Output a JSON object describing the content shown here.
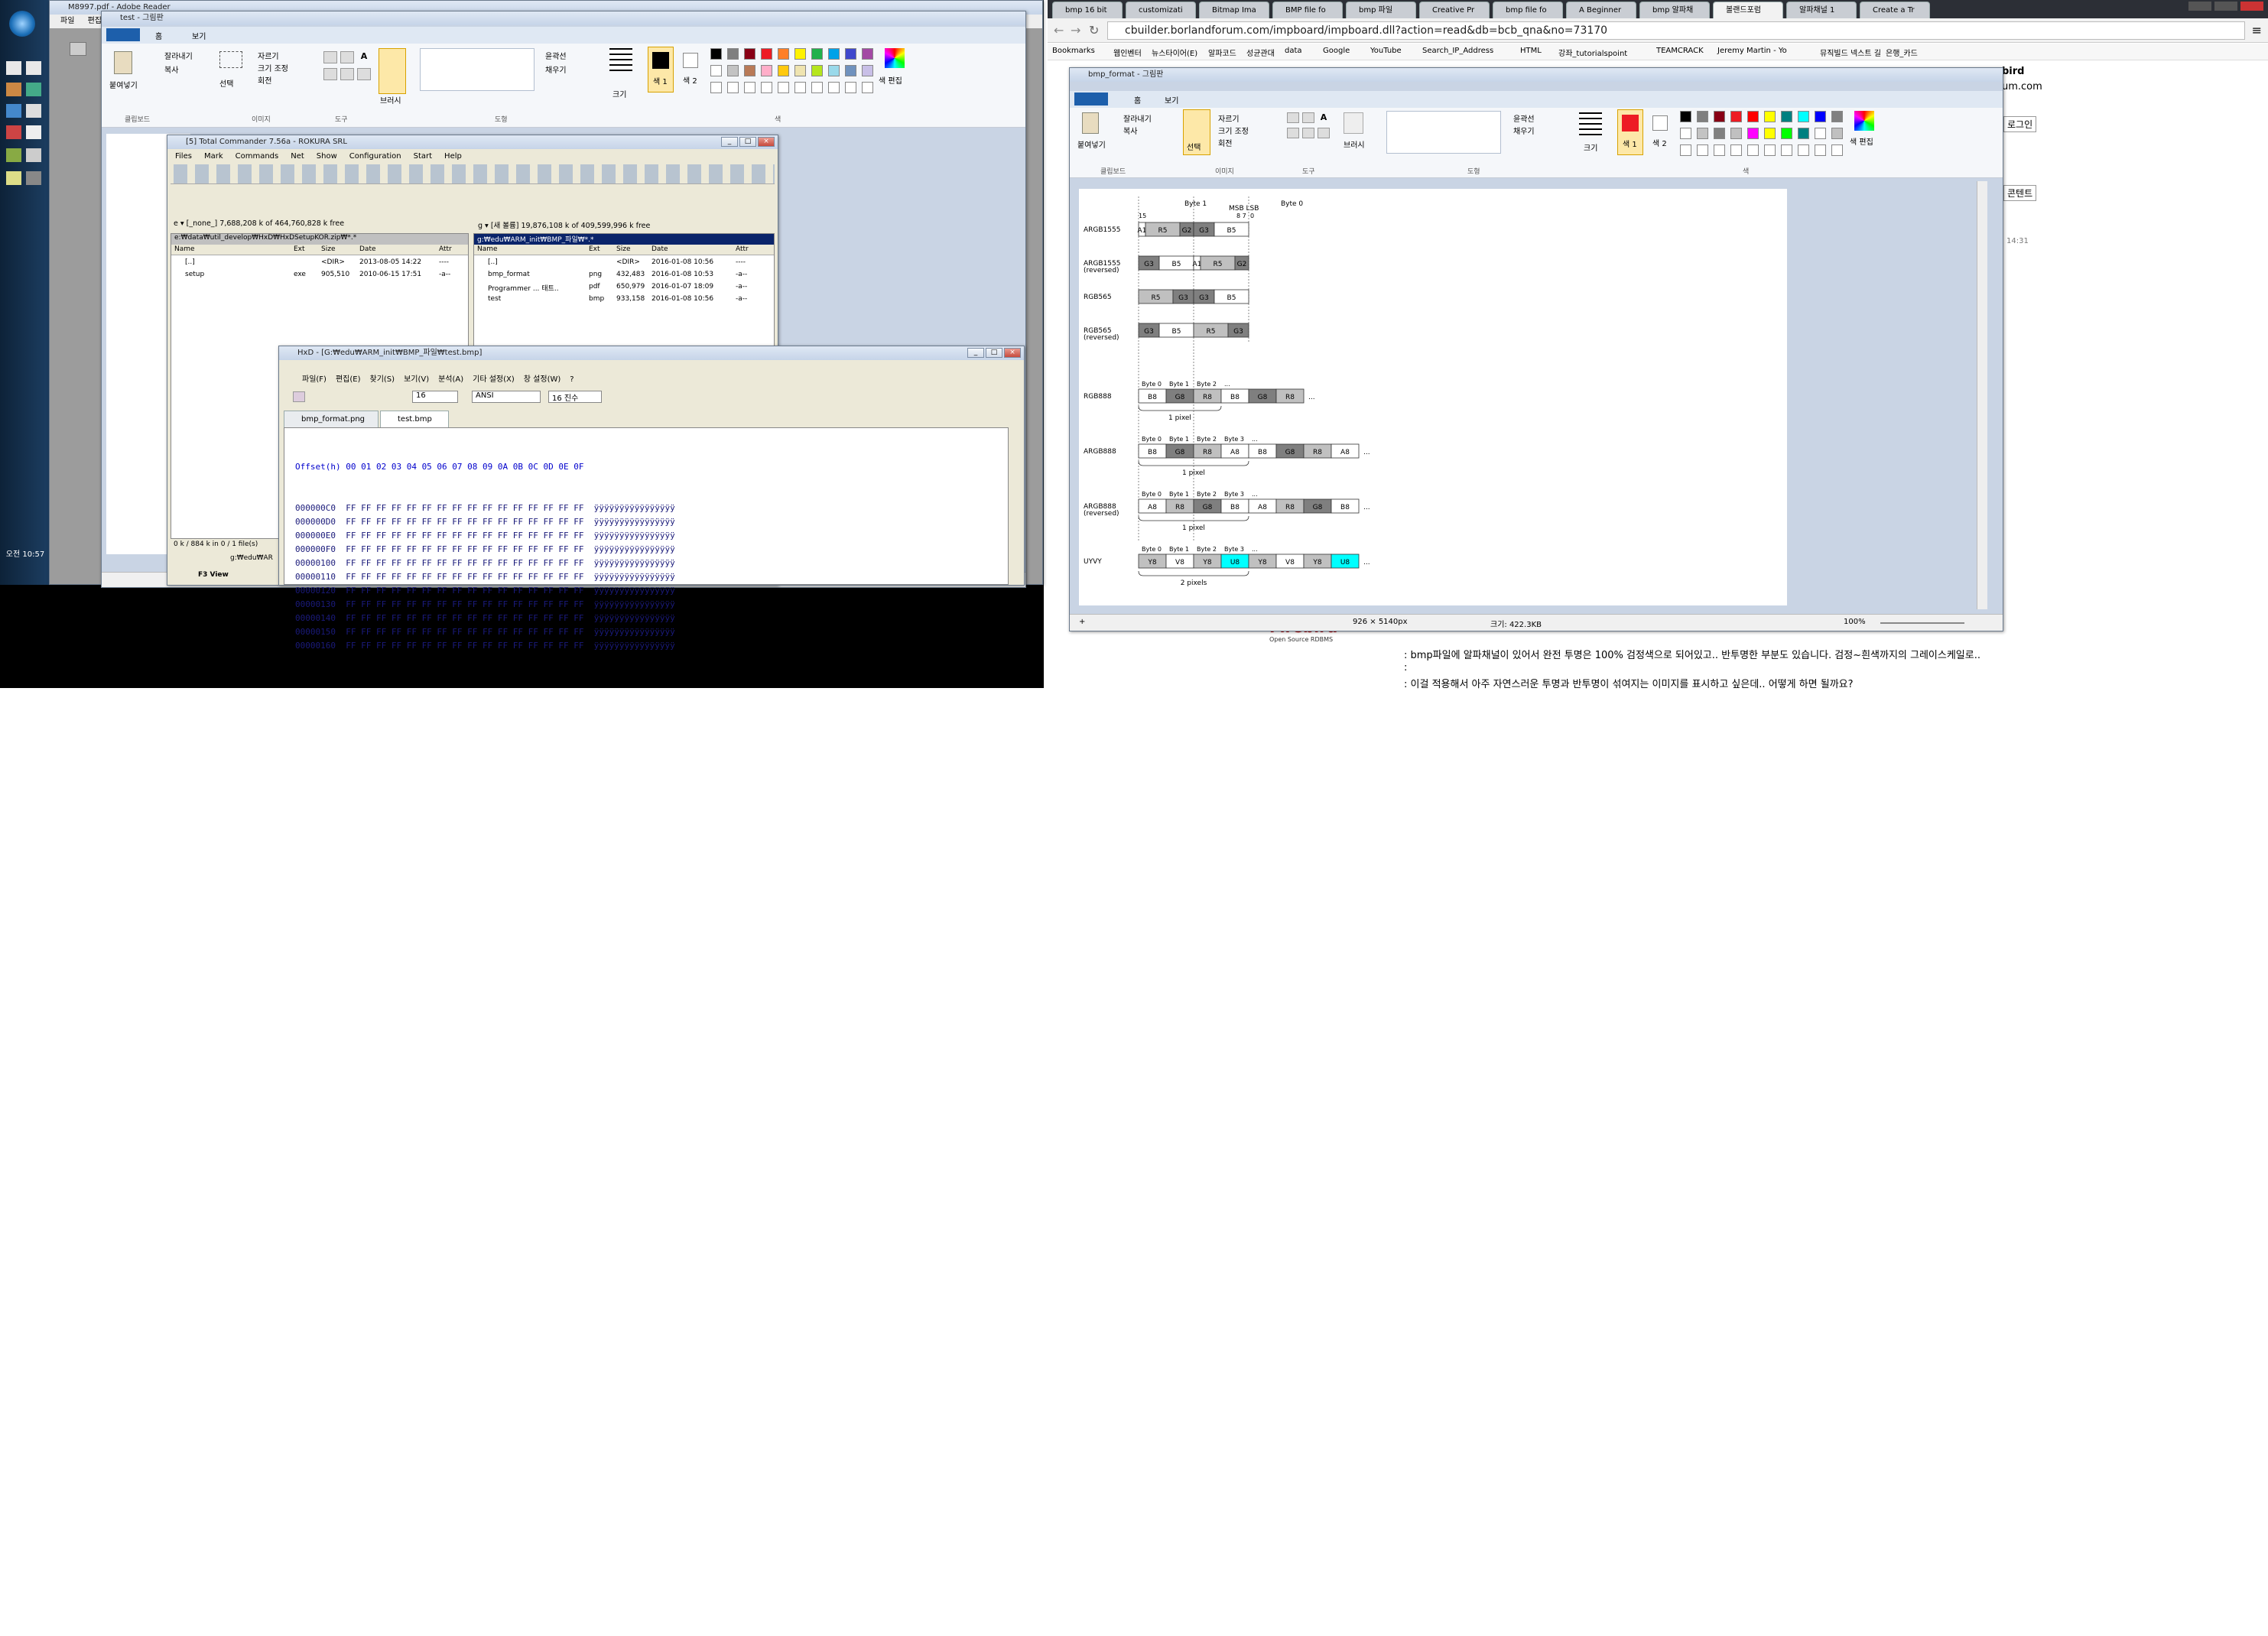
{
  "desktop": {
    "clock": "오전 10:57"
  },
  "left_monitor": {
    "reader_title": "M8997.pdf - Adobe Reader",
    "reader_menu": [
      "파일",
      "편집"
    ],
    "paint": {
      "title": "test - 그림판",
      "tabs": [
        "홈",
        "보기"
      ],
      "clipboard": {
        "paste": "붙여넣기",
        "cut": "잘라내기",
        "copy": "복사",
        "label": "클립보드"
      },
      "image": {
        "select": "선택",
        "crop": "자르기",
        "resize": "크기 조정",
        "rotate": "회전",
        "label": "이미지"
      },
      "tools_label": "도구",
      "brush": "브러시",
      "shapes": {
        "outline": "윤곽선",
        "fill": "채우기",
        "label": "도형"
      },
      "size": "크기",
      "color1": "색 1",
      "color2": "색 2",
      "edit_colors": "색 편집",
      "colors_label": "색"
    },
    "tc": {
      "title": "[5] Total Commander 7.56a - ROKURA SRL",
      "menu": [
        "Files",
        "Mark",
        "Commands",
        "Net",
        "Show",
        "Configuration",
        "Start",
        "Help"
      ],
      "left_drive": "e  ▾  [_none_]  7,688,208 k of 464,760,828 k free",
      "right_drive": "g  ▾  [새 볼륨]  19,876,108 k of 409,599,996 k free",
      "left_path": "e:₩data₩util_develop₩HxD₩HxDSetupKOR.zip₩*.*",
      "right_path": "g:₩edu₩ARM_init₩BMP_파일₩*.*",
      "cols": [
        "Name",
        "Ext",
        "Size",
        "Date",
        "Attr"
      ],
      "left_rows": [
        {
          "name": "[..]",
          "ext": "",
          "size": "<DIR>",
          "date": "2013-08-05 14:22",
          "attr": "----"
        },
        {
          "name": "setup",
          "ext": "exe",
          "size": "905,510",
          "date": "2010-06-15 17:51",
          "attr": "-a--"
        }
      ],
      "right_rows": [
        {
          "name": "[..]",
          "ext": "",
          "size": "<DIR>",
          "date": "2016-01-08 10:56",
          "attr": "----"
        },
        {
          "name": "bmp_format",
          "ext": "png",
          "size": "432,483",
          "date": "2016-01-08 10:53",
          "attr": "-a--"
        },
        {
          "name": "Programmer ... 태트..",
          "ext": "pdf",
          "size": "650,979",
          "date": "2016-01-07 18:09",
          "attr": "-a--"
        },
        {
          "name": "test",
          "ext": "bmp",
          "size": "933,158",
          "date": "2016-01-08 10:56",
          "attr": "-a--"
        }
      ],
      "status": "0 k / 884 k in 0 / 1 file(s)",
      "cmdpath": "g:₩edu₩AR",
      "f3": "F3 View"
    },
    "hxd": {
      "title": "HxD - [G:₩edu₩ARM_init₩BMP_파일₩test.bmp]",
      "menu": [
        "파일(F)",
        "편집(E)",
        "찾기(S)",
        "보기(V)",
        "분석(A)",
        "기타 설정(X)",
        "창 설정(W)",
        "?"
      ],
      "cols_value": "16",
      "charset": "ANSI",
      "base": "16 진수",
      "tabs": [
        "bmp_format.png",
        "test.bmp"
      ],
      "header": "Offset(h) 00 01 02 03 04 05 06 07 08 09 0A 0B 0C 0D 0E 0F",
      "rows": [
        "000000C0  FF FF FF FF FF FF FF FF FF FF FF FF FF FF FF FF  ÿÿÿÿÿÿÿÿÿÿÿÿÿÿÿÿ",
        "000000D0  FF FF FF FF FF FF FF FF FF FF FF FF FF FF FF FF  ÿÿÿÿÿÿÿÿÿÿÿÿÿÿÿÿ",
        "000000E0  FF FF FF FF FF FF FF FF FF FF FF FF FF FF FF FF  ÿÿÿÿÿÿÿÿÿÿÿÿÿÿÿÿ",
        "000000F0  FF FF FF FF FF FF FF FF FF FF FF FF FF FF FF FF  ÿÿÿÿÿÿÿÿÿÿÿÿÿÿÿÿ",
        "00000100  FF FF FF FF FF FF FF FF FF FF FF FF FF FF FF FF  ÿÿÿÿÿÿÿÿÿÿÿÿÿÿÿÿ",
        "00000110  FF FF FF FF FF FF FF FF FF FF FF FF FF FF FF FF  ÿÿÿÿÿÿÿÿÿÿÿÿÿÿÿÿ",
        "00000120  FF FF FF FF FF FF FF FF FF FF FF FF FF FF FF FF  ÿÿÿÿÿÿÿÿÿÿÿÿÿÿÿÿ",
        "00000130  FF FF FF FF FF FF FF FF FF FF FF FF FF FF FF FF  ÿÿÿÿÿÿÿÿÿÿÿÿÿÿÿÿ",
        "00000140  FF FF FF FF FF FF FF FF FF FF FF FF FF FF FF FF  ÿÿÿÿÿÿÿÿÿÿÿÿÿÿÿÿ",
        "00000150  FF FF FF FF FF FF FF FF FF FF FF FF FF FF FF FF  ÿÿÿÿÿÿÿÿÿÿÿÿÿÿÿÿ",
        "00000160  FF FF FF FF FF FF FF FF FF FF FF FF FF FF FF FF  ÿÿÿÿÿÿÿÿÿÿÿÿÿÿÿÿ"
      ]
    }
  },
  "browser": {
    "tabs": [
      "bmp 16 bit",
      "customizati",
      "Bitmap Ima",
      "BMP file fo",
      "bmp 파일",
      "Creative Pr",
      "bmp file fo",
      "A Beginner",
      "bmp 알파채",
      "볼랜드포럼",
      "알파채널 1",
      "Create a Tr"
    ],
    "url": "cbuilder.borlandforum.com/impboard/impboard.dll?action=read&db=bcb_qna&no=73170",
    "bookmarks": [
      "Bookmarks",
      "웹인벤터",
      "뉴스타이어(E)",
      "알파코드",
      "성균관대",
      "data",
      "Google",
      "YouTube",
      "Search_IP_Address",
      "HTML",
      "강좌_tutorialspoint",
      "TEAMCRACK",
      "Jeremy Martin - Yo",
      "뮤직빌드 넥스트 길",
      "은행_카드"
    ],
    "side": [
      "bird",
      "um.com",
      "로그인",
      "콘텐트",
      "14:31"
    ],
    "post": [
      ": bmp파일에 알파채널이 있어서 완전 투명은 100% 검정색으로 되어있고.. 반투명한 부분도 있습니다. 검정~흰색까지의 그레이스케일로..",
      ":",
      ": 이걸 적용해서 아주 자연스러운 투명과 반투명이 섞여지는 이미지를 표시하고 싶은데.. 어떻게 하면 될까요?"
    ],
    "logo_text": "Firebird",
    "logo_sub": "Open Source RDBMS"
  },
  "paint2": {
    "title": "bmp_format - 그림판",
    "tabs": [
      "홈",
      "보기"
    ],
    "clipboard": {
      "paste": "붙여넣기",
      "cut": "잘라내기",
      "copy": "복사",
      "label": "클립보드"
    },
    "image": {
      "select": "선택",
      "crop": "자르기",
      "resize": "크기 조정",
      "rotate": "회전",
      "label": "이미지"
    },
    "tools_label": "도구",
    "brush": "브러시",
    "shapes": {
      "outline": "윤곽선",
      "fill": "채우기",
      "label": "도형"
    },
    "size": "크기",
    "color1": "색 1",
    "color2": "색 2",
    "edit_colors": "색 편집",
    "colors_label": "색",
    "status_dims": "926 × 5140px",
    "status_size": "크기: 422.3KB",
    "zoom": "100%"
  },
  "diagram": {
    "top_headers": {
      "byte1": "Byte 1",
      "msb_lsb": "MSB LSB",
      "bits87": "8 7",
      "byte0": "Byte 0",
      "b15": "15",
      "b0": "0"
    },
    "rows": [
      {
        "label": "ARGB1555",
        "cells": [
          {
            "t": "A1",
            "w": 1,
            "c": "w"
          },
          {
            "t": "R5",
            "w": 5,
            "c": "l"
          },
          {
            "t": "G2",
            "w": 2,
            "c": "d"
          },
          {
            "t": "G3",
            "w": 3,
            "c": "d"
          },
          {
            "t": "B5",
            "w": 5,
            "c": "w"
          }
        ]
      },
      {
        "label": "ARGB1555 (reversed)",
        "cells": [
          {
            "t": "G3",
            "w": 3,
            "c": "d"
          },
          {
            "t": "B5",
            "w": 5,
            "c": "w"
          },
          {
            "t": "A1",
            "w": 1,
            "c": "w"
          },
          {
            "t": "R5",
            "w": 5,
            "c": "l"
          },
          {
            "t": "G2",
            "w": 2,
            "c": "d"
          }
        ]
      },
      {
        "label": "RGB565",
        "cells": [
          {
            "t": "R5",
            "w": 5,
            "c": "l"
          },
          {
            "t": "G3",
            "w": 3,
            "c": "d"
          },
          {
            "t": "G3",
            "w": 3,
            "c": "d"
          },
          {
            "t": "B5",
            "w": 5,
            "c": "w"
          }
        ]
      },
      {
        "label": "RGB565 (reversed)",
        "cells": [
          {
            "t": "G3",
            "w": 3,
            "c": "d"
          },
          {
            "t": "B5",
            "w": 5,
            "c": "w"
          },
          {
            "t": "R5",
            "w": 5,
            "c": "l"
          },
          {
            "t": "G3",
            "w": 3,
            "c": "d"
          }
        ]
      }
    ],
    "byte_rows": [
      {
        "label": "RGB888",
        "heads": [
          "Byte 0",
          "Byte 1",
          "Byte 2",
          "..."
        ],
        "cells": [
          {
            "t": "B8",
            "c": "w"
          },
          {
            "t": "G8",
            "c": "d"
          },
          {
            "t": "R8",
            "c": "l"
          },
          {
            "t": "B8",
            "c": "w"
          },
          {
            "t": "G8",
            "c": "d"
          },
          {
            "t": "R8",
            "c": "l"
          }
        ],
        "span": "1 pixel",
        "span_n": 3
      },
      {
        "label": "ARGB888",
        "heads": [
          "Byte 0",
          "Byte 1",
          "Byte 2",
          "Byte 3",
          "..."
        ],
        "cells": [
          {
            "t": "B8",
            "c": "w"
          },
          {
            "t": "G8",
            "c": "d"
          },
          {
            "t": "R8",
            "c": "l"
          },
          {
            "t": "A8",
            "c": "w"
          },
          {
            "t": "B8",
            "c": "w"
          },
          {
            "t": "G8",
            "c": "d"
          },
          {
            "t": "R8",
            "c": "l"
          },
          {
            "t": "A8",
            "c": "w"
          }
        ],
        "span": "1 pixel",
        "span_n": 4
      },
      {
        "label": "ARGB888 (reversed)",
        "heads": [
          "Byte 0",
          "Byte 1",
          "Byte 2",
          "Byte 3",
          "..."
        ],
        "cells": [
          {
            "t": "A8",
            "c": "w"
          },
          {
            "t": "R8",
            "c": "l"
          },
          {
            "t": "G8",
            "c": "d"
          },
          {
            "t": "B8",
            "c": "w"
          },
          {
            "t": "A8",
            "c": "w"
          },
          {
            "t": "R8",
            "c": "l"
          },
          {
            "t": "G8",
            "c": "d"
          },
          {
            "t": "B8",
            "c": "w"
          }
        ],
        "span": "1 pixel",
        "span_n": 4
      },
      {
        "label": "UYVY",
        "heads": [
          "Byte 0",
          "Byte 1",
          "Byte 2",
          "Byte 3",
          "..."
        ],
        "cells": [
          {
            "t": "Y8",
            "c": "l"
          },
          {
            "t": "V8",
            "c": "w"
          },
          {
            "t": "Y8",
            "c": "l"
          },
          {
            "t": "U8",
            "c": "c"
          },
          {
            "t": "Y8",
            "c": "l"
          },
          {
            "t": "V8",
            "c": "w"
          },
          {
            "t": "Y8",
            "c": "l"
          },
          {
            "t": "U8",
            "c": "c"
          }
        ],
        "span": "2 pixels",
        "span_n": 4
      }
    ],
    "colors": {
      "w": "#ffffff",
      "l": "#c0c0c0",
      "d": "#7f7f7f",
      "c": "#00ffff"
    }
  },
  "palette": [
    "#000000",
    "#7f7f7f",
    "#880015",
    "#ed1c24",
    "#ff7f27",
    "#fff200",
    "#22b14c",
    "#00a2e8",
    "#3f48cc",
    "#a349a4",
    "#ffffff",
    "#c3c3c3",
    "#b97a57",
    "#ffaec9",
    "#ffc90e",
    "#efe4b0",
    "#b5e61d",
    "#99d9ea",
    "#7092be",
    "#c8bfe7"
  ],
  "palette2": [
    "#000000",
    "#7f7f7f",
    "#880015",
    "#ed1c24",
    "#ff0000",
    "#ffff00",
    "#008080",
    "#00ffff",
    "#0000ff",
    "#808080",
    "#ffffff",
    "#c3c3c3",
    "#808080",
    "#c0c0c0",
    "#ff00ff",
    "#ffff00",
    "#00ff00",
    "#008080",
    "#ffffff",
    "#c0c0c0"
  ]
}
